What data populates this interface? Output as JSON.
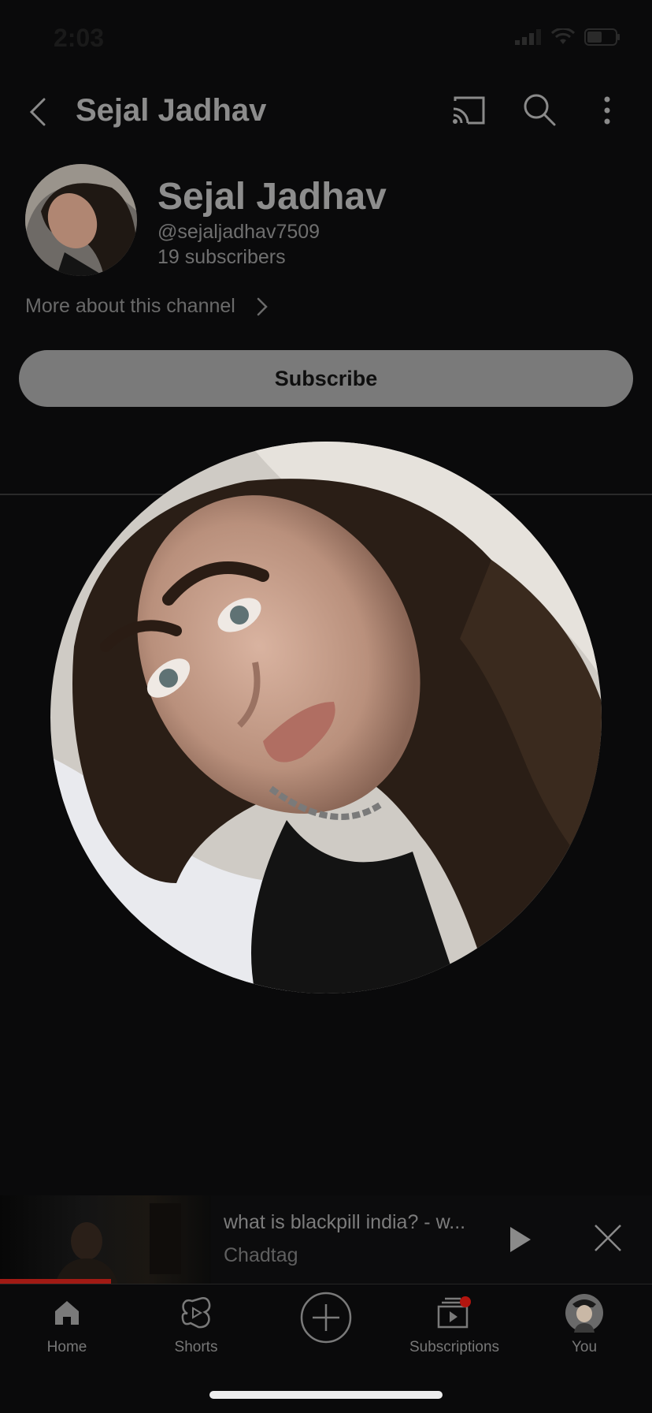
{
  "status_bar": {
    "time": "2:03"
  },
  "header": {
    "title": "Sejal Jadhav"
  },
  "channel": {
    "name": "Sejal Jadhav",
    "handle": "@sejaljadhav7509",
    "subscribers": "19 subscribers",
    "more_about": "More about this channel",
    "subscribe_label": "Subscribe"
  },
  "mini_player": {
    "title": "what is blackpill india? - w...",
    "channel": "Chadtag",
    "progress_fraction": 0.17
  },
  "bottom_nav": {
    "items": [
      {
        "label": "Home",
        "icon": "home-icon"
      },
      {
        "label": "Shorts",
        "icon": "shorts-icon"
      },
      {
        "label": "",
        "icon": "create-icon"
      },
      {
        "label": "Subscriptions",
        "icon": "subscriptions-icon"
      },
      {
        "label": "You",
        "icon": "avatar"
      }
    ]
  },
  "colors": {
    "background": "#0a0a0b",
    "subscribe_button": "#7a7a7a",
    "progress": "#a11a14",
    "notification_dot": "#b3150f"
  }
}
